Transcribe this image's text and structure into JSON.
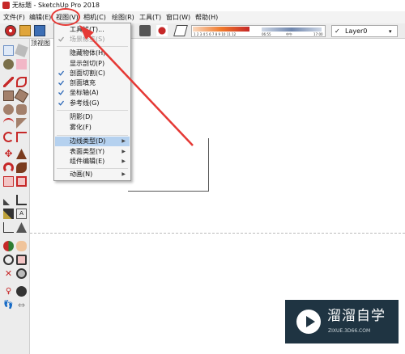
{
  "window": {
    "title": "无标题 - SketchUp Pro 2018"
  },
  "menubar": [
    "文件(F)",
    "编辑(E)",
    "视图(V)",
    "相机(C)",
    "绘图(R)",
    "工具(T)",
    "窗口(W)",
    "帮助(H)"
  ],
  "view_menu": {
    "items": [
      {
        "label": "工具栏(T)...",
        "checked": false,
        "disabled": false,
        "submenu": false,
        "highlighted": false
      },
      {
        "label": "场景标签(S)",
        "checked": true,
        "disabled": true,
        "submenu": false,
        "highlighted": false
      },
      {
        "label": "隐藏物体(H)",
        "checked": false,
        "disabled": false,
        "submenu": false,
        "highlighted": false
      },
      {
        "label": "显示剖切(P)",
        "checked": false,
        "disabled": false,
        "submenu": false,
        "highlighted": false
      },
      {
        "label": "剖面切割(C)",
        "checked": true,
        "disabled": false,
        "submenu": false,
        "highlighted": false
      },
      {
        "label": "剖面填充",
        "checked": true,
        "disabled": false,
        "submenu": false,
        "highlighted": false
      },
      {
        "label": "坐标轴(A)",
        "checked": true,
        "disabled": false,
        "submenu": false,
        "highlighted": false
      },
      {
        "label": "参考线(G)",
        "checked": true,
        "disabled": false,
        "submenu": false,
        "highlighted": false
      },
      {
        "label": "阴影(D)",
        "checked": false,
        "disabled": false,
        "submenu": false,
        "highlighted": false
      },
      {
        "label": "雾化(F)",
        "checked": false,
        "disabled": false,
        "submenu": false,
        "highlighted": false
      },
      {
        "label": "边线类型(D)",
        "checked": false,
        "disabled": false,
        "submenu": true,
        "highlighted": true
      },
      {
        "label": "表面类型(Y)",
        "checked": false,
        "disabled": false,
        "submenu": true,
        "highlighted": false
      },
      {
        "label": "组件编辑(E)",
        "checked": false,
        "disabled": false,
        "submenu": true,
        "highlighted": false
      },
      {
        "label": "动画(N)",
        "checked": false,
        "disabled": false,
        "submenu": true,
        "highlighted": false
      }
    ]
  },
  "shadow_bar": {
    "months": "1 2 3 4 5 6 7 8 9 10 11 12",
    "time_start": "06:55",
    "noon": "中午",
    "time_end": "17:00"
  },
  "layer": {
    "label": "Layer0"
  },
  "scene": {
    "tab_label": "顶视图"
  },
  "watermark": {
    "title": "溜溜自学",
    "url": "ZIXUE.3D66.COM"
  },
  "colors": {
    "annotation": "#e53935",
    "highlight": "#b5d1ef",
    "brand": "#c62828"
  }
}
